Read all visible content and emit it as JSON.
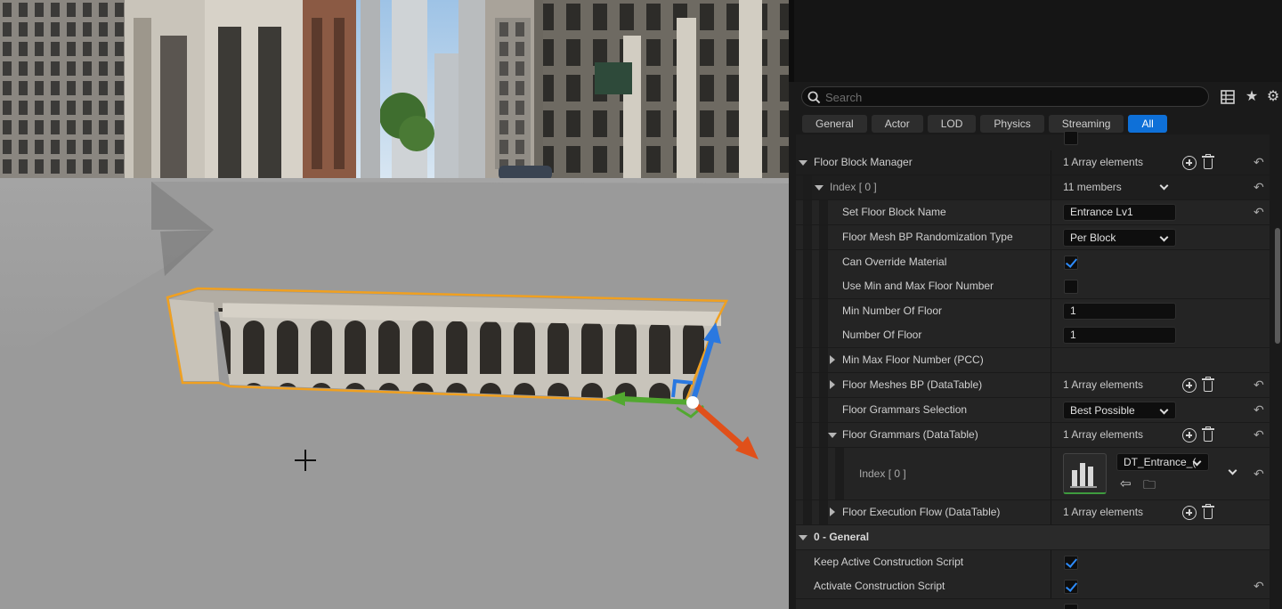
{
  "search": {
    "placeholder": "Search"
  },
  "toolbar_icons": [
    "table-view-icon",
    "star-icon",
    "settings-icon"
  ],
  "filter_tabs": [
    {
      "label": "General",
      "active": false
    },
    {
      "label": "Actor",
      "active": false
    },
    {
      "label": "LOD",
      "active": false
    },
    {
      "label": "Physics",
      "active": false
    },
    {
      "label": "Streaming",
      "active": false
    },
    {
      "label": "All",
      "active": true
    }
  ],
  "properties": {
    "floor_block_manager": {
      "label": "Floor Block Manager",
      "value": "1 Array elements"
    },
    "index0": {
      "label": "Index [ 0 ]",
      "value": "11 members"
    },
    "set_floor_block_name": {
      "label": "Set Floor Block Name",
      "value": "Entrance Lv1"
    },
    "floor_mesh_bp_randomization_type": {
      "label": "Floor Mesh BP Randomization Type",
      "value": "Per Block"
    },
    "can_override_material": {
      "label": "Can Override Material",
      "checked": true
    },
    "use_min_max_floor_number": {
      "label": "Use Min and Max Floor Number",
      "checked": false
    },
    "min_number_of_floor": {
      "label": "Min Number Of Floor",
      "value": "1"
    },
    "number_of_floor": {
      "label": "Number Of Floor",
      "value": "1"
    },
    "min_max_floor_number_pcc": {
      "label": "Min Max Floor Number (PCC)"
    },
    "floor_meshes_bp": {
      "label": "Floor Meshes BP (DataTable)",
      "value": "1 Array elements"
    },
    "floor_grammars_selection": {
      "label": "Floor Grammars Selection",
      "value": "Best Possible"
    },
    "floor_grammars_datatable": {
      "label": "Floor Grammars (DataTable)",
      "value": "1 Array elements"
    },
    "grammar_index0": {
      "label": "Index [ 0 ]",
      "asset": "DT_Entrance_("
    },
    "floor_execution_flow": {
      "label": "Floor Execution Flow (DataTable)",
      "value": "1 Array elements"
    }
  },
  "general_section": {
    "label": "0 - General",
    "keep_active_construction_script": {
      "label": "Keep Active Construction Script",
      "checked": true
    },
    "activate_construction_script": {
      "label": "Activate Construction Script",
      "checked": true
    }
  },
  "colors": {
    "accent": "#0e70d8",
    "selection_outline": "#f0a020",
    "gizmo_x": "#e0501a",
    "gizmo_y": "#52a830",
    "gizmo_z": "#2a78e0"
  }
}
